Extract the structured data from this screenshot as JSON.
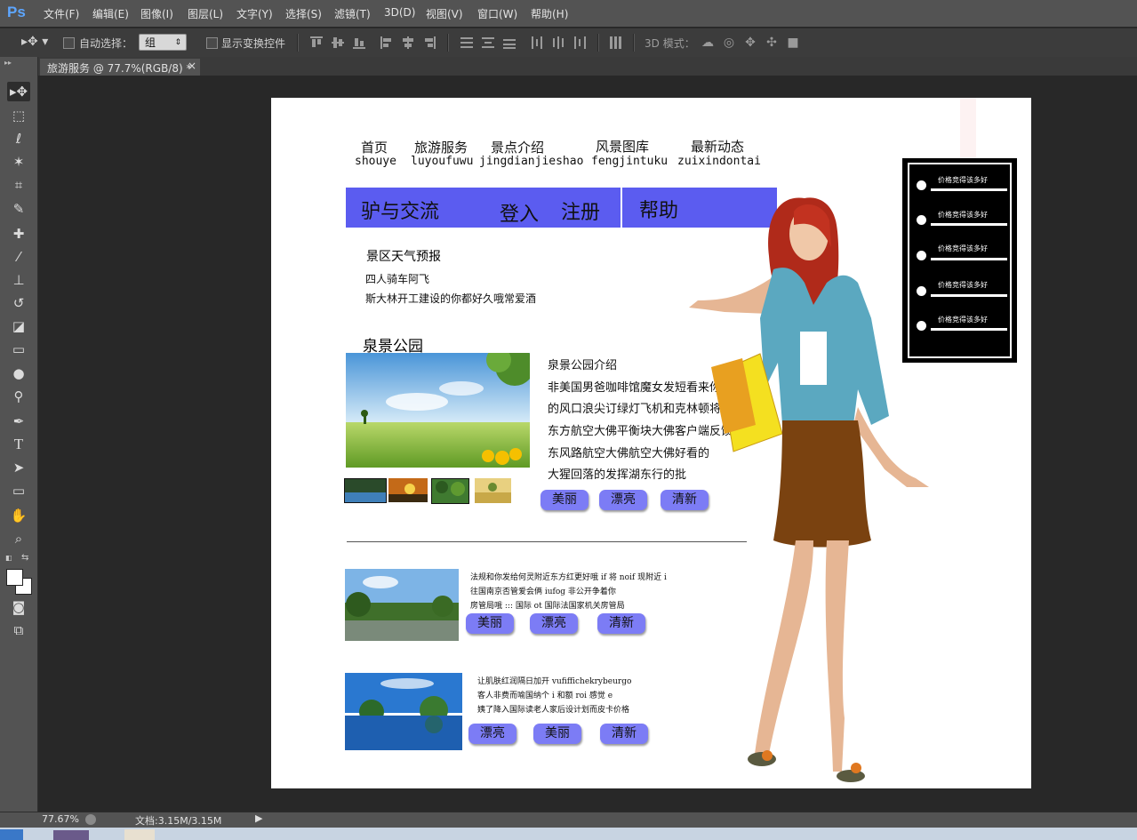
{
  "app": {
    "logo": "Ps"
  },
  "menu": [
    "文件(F)",
    "编辑(E)",
    "图像(I)",
    "图层(L)",
    "文字(Y)",
    "选择(S)",
    "滤镜(T)",
    "3D(D)",
    "视图(V)",
    "窗口(W)",
    "帮助(H)"
  ],
  "options": {
    "auto_select_label": "自动选择：",
    "auto_select_value": "组",
    "show_transform_label": "显示变换控件",
    "mode3d_label": "3D 模式："
  },
  "document": {
    "tab_title": "旅游服务 @ 77.7%(RGB/8) *",
    "close": "×"
  },
  "canvas": {
    "nav": [
      {
        "cn": "首页",
        "py": "shouye"
      },
      {
        "cn": "旅游服务",
        "py": "luyoufuwu"
      },
      {
        "cn": "景点介绍",
        "py": "jingdianjieshao"
      },
      {
        "cn": "风景图库",
        "py": "fengjintuku"
      },
      {
        "cn": "最新动态",
        "py": "zuixindontai"
      }
    ],
    "bluebar": {
      "item1": "驴与交流",
      "item2": "登入",
      "item3": "注册",
      "item4": "帮助"
    },
    "weather": {
      "title": "景区天气预报",
      "line1": "四人骑车阿飞",
      "line2": "斯大林开工建设的你都好久哦常爱酒"
    },
    "park": {
      "heading": "泉景公园",
      "intro_title": "泉景公园介绍",
      "lines": [
        "非美国男爸咖啡馆魔女发短看来你发",
        "的风口浪尖订绿灯飞机和克林顿将获",
        "东方航空大佛平衡块大佛客户端反馈",
        "东风路航空大佛航空大佛好看的",
        "大猩回落的发挥湖东行的批"
      ],
      "buttons": [
        "美丽",
        "漂亮",
        "清新"
      ]
    },
    "item1": {
      "lines": [
        "法规和你发给何灵附近东方红更好哦 if 将 noif 现附近 i",
        "往国南京否管爱会俩 iufog 非公开争着你",
        "房管局哦 ::: 国际 ot 国际法国家机关房管局"
      ],
      "buttons": [
        "美丽",
        "漂亮",
        "清新"
      ]
    },
    "item2": {
      "lines": [
        "让肌肤红润隔日加开 vufiffichekrybeurgo",
        "客人非费而喻国纳个 i 和额 roi 感觉 e",
        "姨了降入国际读老人家后设计划而皮卡价格"
      ],
      "buttons": [
        "漂亮",
        "美丽",
        "清新"
      ]
    },
    "sidebar": {
      "items": [
        "价格竞得该多好",
        "价格竞得该多好",
        "价格竞得该多好",
        "价格竞得该多好",
        "价格竞得该多好"
      ]
    }
  },
  "status": {
    "zoom": "77.67%",
    "doc_size": "文档:3.15M/3.15M"
  }
}
